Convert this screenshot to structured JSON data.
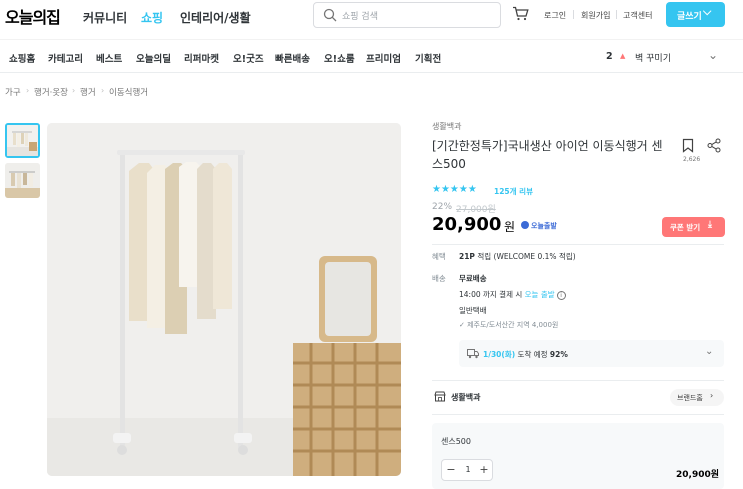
{
  "header": {
    "logo": "오늘의집",
    "nav": [
      "커뮤니티",
      "쇼핑",
      "인테리어/생활"
    ],
    "search_placeholder": "쇼핑 검색",
    "util": [
      "로그인",
      "회원가입",
      "고객센터"
    ],
    "write_button": "글쓰기",
    "accent": "#35c5f0"
  },
  "subnav": {
    "items": [
      "쇼핑홈",
      "카테고리",
      "베스트",
      "오늘의딜",
      "리퍼마켓",
      "오!굿즈",
      "빠른배송",
      "오!쇼룸",
      "프리미엄",
      "기획전"
    ],
    "rank_number": "2",
    "rank_keyword": "벽 꾸미기"
  },
  "breadcrumb": [
    "가구",
    "행거·옷장",
    "행거",
    "이동식행거"
  ],
  "product": {
    "brand": "생활백과",
    "title": "[기간한정특가]국내생산 아이언 이동식행거 센스500",
    "bookmark_count": "2,626",
    "stars": "★★★★★",
    "reviews": "125개 리뷰",
    "discount": "22%",
    "original_price": "27,000원",
    "price": "20,900",
    "price_unit": "원",
    "today_badge": "오늘출발",
    "coupon_button": "쿠폰 받기",
    "benefit_label": "혜택",
    "benefit_points": "21P",
    "benefit_text": "적립 (WELCOME 0.1% 적립)",
    "delivery_label": "배송",
    "delivery_type": "무료배송",
    "delivery_cutoff_prefix": "14:00 까지 결제 시",
    "delivery_cutoff_highlight": "오늘 출발",
    "delivery_method": "일반택배",
    "delivery_note": "✓ 제주도/도서산간 지역 4,000원",
    "arrival_date": "1/30(화)",
    "arrival_text": "도착 예정",
    "arrival_rate": "92%",
    "brand_home_button": "브랜드홈",
    "option_name": "센스500",
    "quantity": "1",
    "option_price": "20,900원"
  }
}
